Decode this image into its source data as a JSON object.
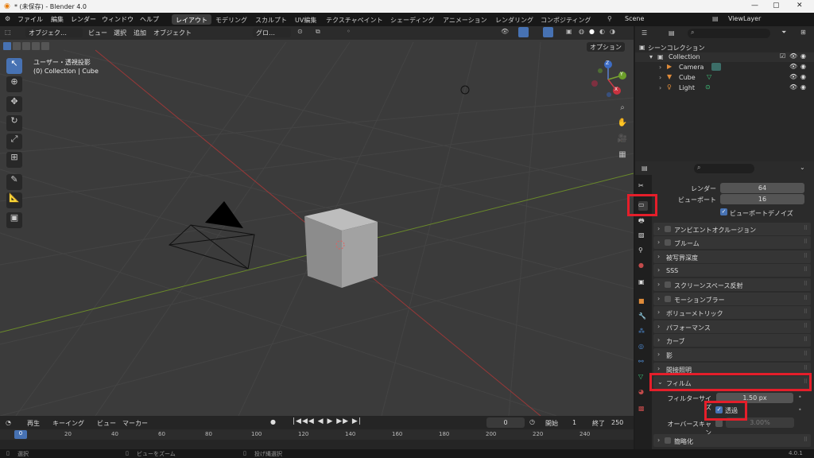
{
  "window": {
    "title": "* (未保存) - Blender 4.0",
    "min": "—",
    "max": "▢",
    "close": "✕"
  },
  "menu": {
    "items": [
      "ファイル",
      "編集",
      "レンダー",
      "ウィンドウ",
      "ヘルプ"
    ]
  },
  "workspaces": [
    "レイアウト",
    "モデリング",
    "スカルプト",
    "UV編集",
    "テクスチャペイント",
    "シェーディング",
    "アニメーション",
    "レンダリング",
    "コンポジティング"
  ],
  "scene": {
    "name": "Scene"
  },
  "view_layer": {
    "name": "ViewLayer"
  },
  "viewport": {
    "mode": "オブジェク…",
    "menus": [
      "ビュー",
      "選択",
      "追加",
      "オブジェクト"
    ],
    "transform": "グロ…",
    "options_label": "オプション",
    "info_line1": "ユーザー・透視投影",
    "info_line2": "(0) Collection | Cube",
    "axes": {
      "z": "Z",
      "y": "Y",
      "x": "X"
    }
  },
  "outliner": {
    "root": "シーンコレクション",
    "collection": "Collection",
    "objects": [
      {
        "name": "Camera"
      },
      {
        "name": "Cube"
      },
      {
        "name": "Light"
      }
    ]
  },
  "properties": {
    "render_label": "レンダー",
    "render_value": "64",
    "viewport_label": "ビューポート",
    "viewport_value": "16",
    "denoise_label": "ビューポートデノイズ",
    "panels": [
      "アンビエントオクルージョン",
      "ブルーム",
      "被写界深度",
      "SSS",
      "スクリーンスペース反射",
      "モーションブラー",
      "ボリューメトリック",
      "パフォーマンス",
      "カーブ",
      "影",
      "間接照明"
    ],
    "film_label": "フィルム",
    "filter_size_label": "フィルターサイズ",
    "filter_size_value": "1.50 px",
    "transparent_label": "透過",
    "overscan_label": "オーバースキャン",
    "overscan_value": "3.00%",
    "simplify_label": "簡略化"
  },
  "timeline": {
    "menus": [
      "再生",
      "キーイング",
      "ビュー",
      "マーカー"
    ],
    "current_frame": "0",
    "start_label": "開始",
    "start": "1",
    "end_label": "終了",
    "end": "250",
    "ticks": [
      "0",
      "20",
      "40",
      "60",
      "80",
      "100",
      "120",
      "140",
      "160",
      "180",
      "200",
      "220",
      "240"
    ]
  },
  "status": {
    "select": "選択",
    "zoom": "ビューをズーム",
    "lasso": "投げ縄選択",
    "version": "4.0.1"
  },
  "colors": {
    "accent": "#4772b3",
    "highlight": "#e51e2a"
  }
}
